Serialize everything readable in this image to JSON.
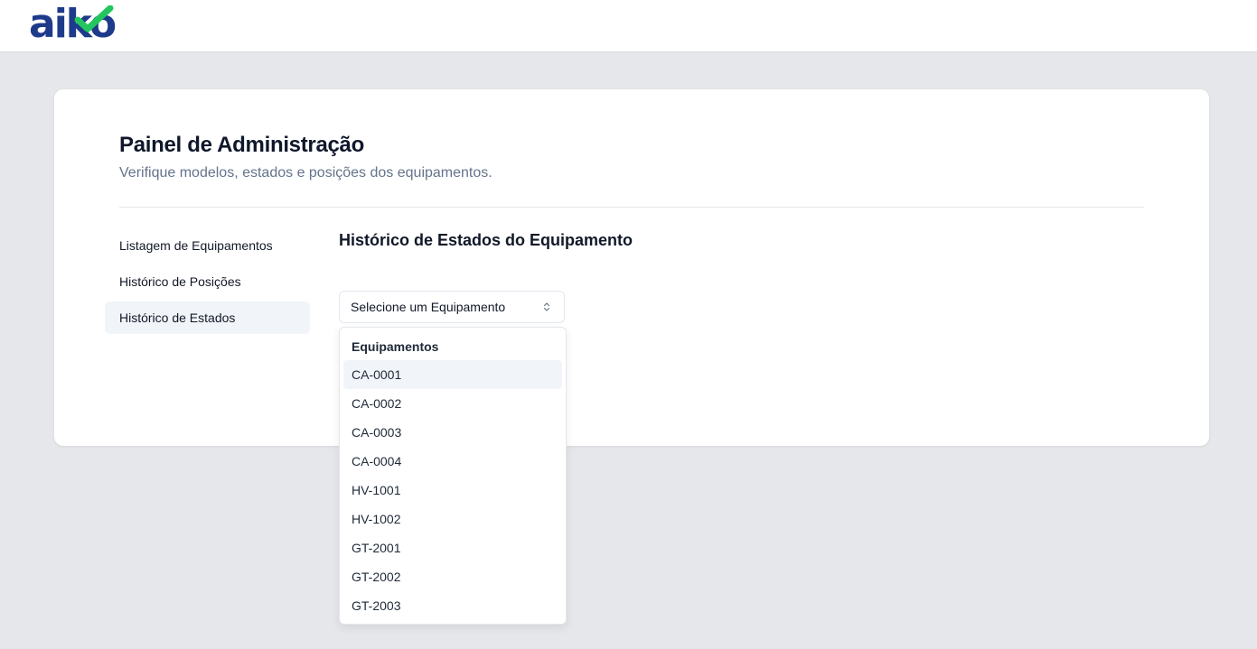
{
  "header": {
    "logo_text": "aiko",
    "logo_check_color": "#22c55e",
    "logo_text_color": "#1e3a8a"
  },
  "admin": {
    "title": "Painel de Administração",
    "subtitle": "Verifique modelos, estados e posições dos equipamentos."
  },
  "sidebar": {
    "items": [
      {
        "label": "Listagem de Equipamentos",
        "active": false
      },
      {
        "label": "Histórico de Posições",
        "active": false
      },
      {
        "label": "Histórico de Estados",
        "active": true
      }
    ]
  },
  "main": {
    "section_title": "Histórico de Estados do Equipamento",
    "select": {
      "placeholder": "Selecione um Equipamento",
      "icon": "chevrons-up-down-icon",
      "group_label": "Equipamentos",
      "highlighted_option": "CA-0001",
      "options": [
        "CA-0001",
        "CA-0002",
        "CA-0003",
        "CA-0004",
        "HV-1001",
        "HV-1002",
        "GT-2001",
        "GT-2002",
        "GT-2003"
      ]
    }
  }
}
